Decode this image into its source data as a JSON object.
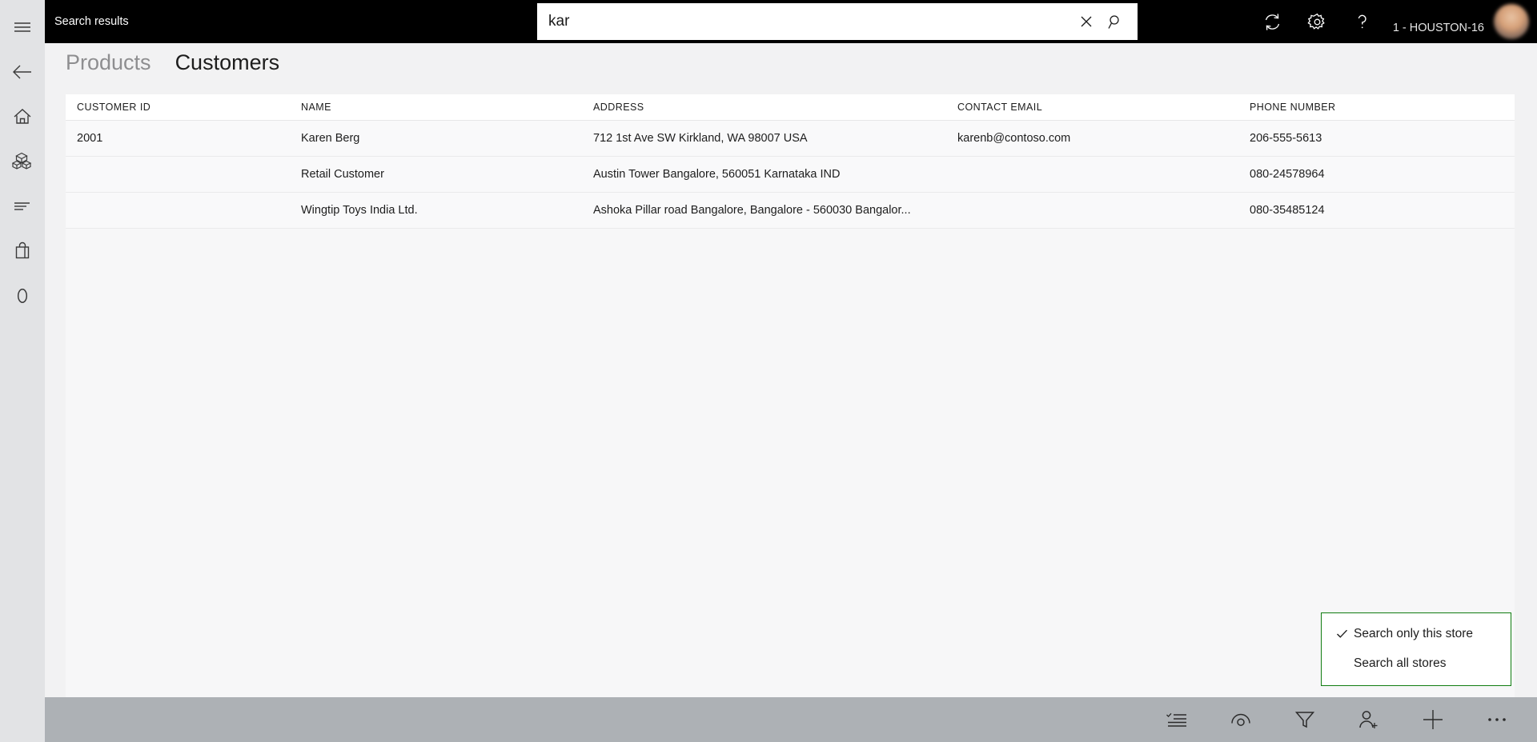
{
  "rail": {
    "items": [
      {
        "name": "menu-icon",
        "label": "Menu"
      },
      {
        "name": "back-icon",
        "label": "Back"
      },
      {
        "name": "home-icon",
        "label": "Home"
      },
      {
        "name": "products-icon",
        "label": "Products"
      },
      {
        "name": "list-lines-icon",
        "label": "Transactions"
      },
      {
        "name": "shopping-bag-icon",
        "label": "Cart"
      },
      {
        "name": "oval-icon",
        "label": "Settings"
      }
    ]
  },
  "topbar": {
    "title": "Search results",
    "search": {
      "value": "kar",
      "placeholder": "Search"
    },
    "clear_icon": "close-icon",
    "search_icon": "search-icon",
    "icons": [
      {
        "name": "refresh-icon",
        "label": "Refresh"
      },
      {
        "name": "gear-icon",
        "label": "Settings"
      },
      {
        "name": "help-icon",
        "label": "Help"
      }
    ],
    "user": {
      "name": "",
      "store": "1 - HOUSTON-16"
    }
  },
  "tabs": [
    {
      "label": "Products",
      "active": false
    },
    {
      "label": "Customers",
      "active": true
    }
  ],
  "grid": {
    "columns": [
      "CUSTOMER ID",
      "NAME",
      "ADDRESS",
      "CONTACT EMAIL",
      "PHONE NUMBER"
    ],
    "rows": [
      {
        "customer_id": "2001",
        "name": "Karen Berg",
        "address": "712 1st Ave SW Kirkland, WA 98007 USA",
        "contact_email": "karenb@contoso.com",
        "phone_number": "206-555-5613"
      },
      {
        "customer_id": "",
        "name": "Retail Customer",
        "address": "Austin Tower Bangalore, 560051 Karnataka IND",
        "contact_email": "",
        "phone_number": "080-24578964"
      },
      {
        "customer_id": "",
        "name": "Wingtip Toys India Ltd.",
        "address": "Ashoka Pillar road Bangalore, Bangalore - 560030 Bangalor...",
        "contact_email": "",
        "phone_number": "080-35485124"
      }
    ]
  },
  "dropdown": {
    "border_color": "#107c10",
    "items": [
      {
        "label": "Search only this store",
        "checked": true
      },
      {
        "label": "Search all stores",
        "checked": false
      }
    ]
  },
  "bottombar": {
    "icons": [
      {
        "name": "select-list-icon",
        "label": "Select"
      },
      {
        "name": "view-eye-icon",
        "label": "View details"
      },
      {
        "name": "filter-icon",
        "label": "Filter"
      },
      {
        "name": "add-person-icon",
        "label": "Add customer"
      },
      {
        "name": "plus-icon",
        "label": "New"
      },
      {
        "name": "more-icon",
        "label": "More"
      }
    ]
  }
}
